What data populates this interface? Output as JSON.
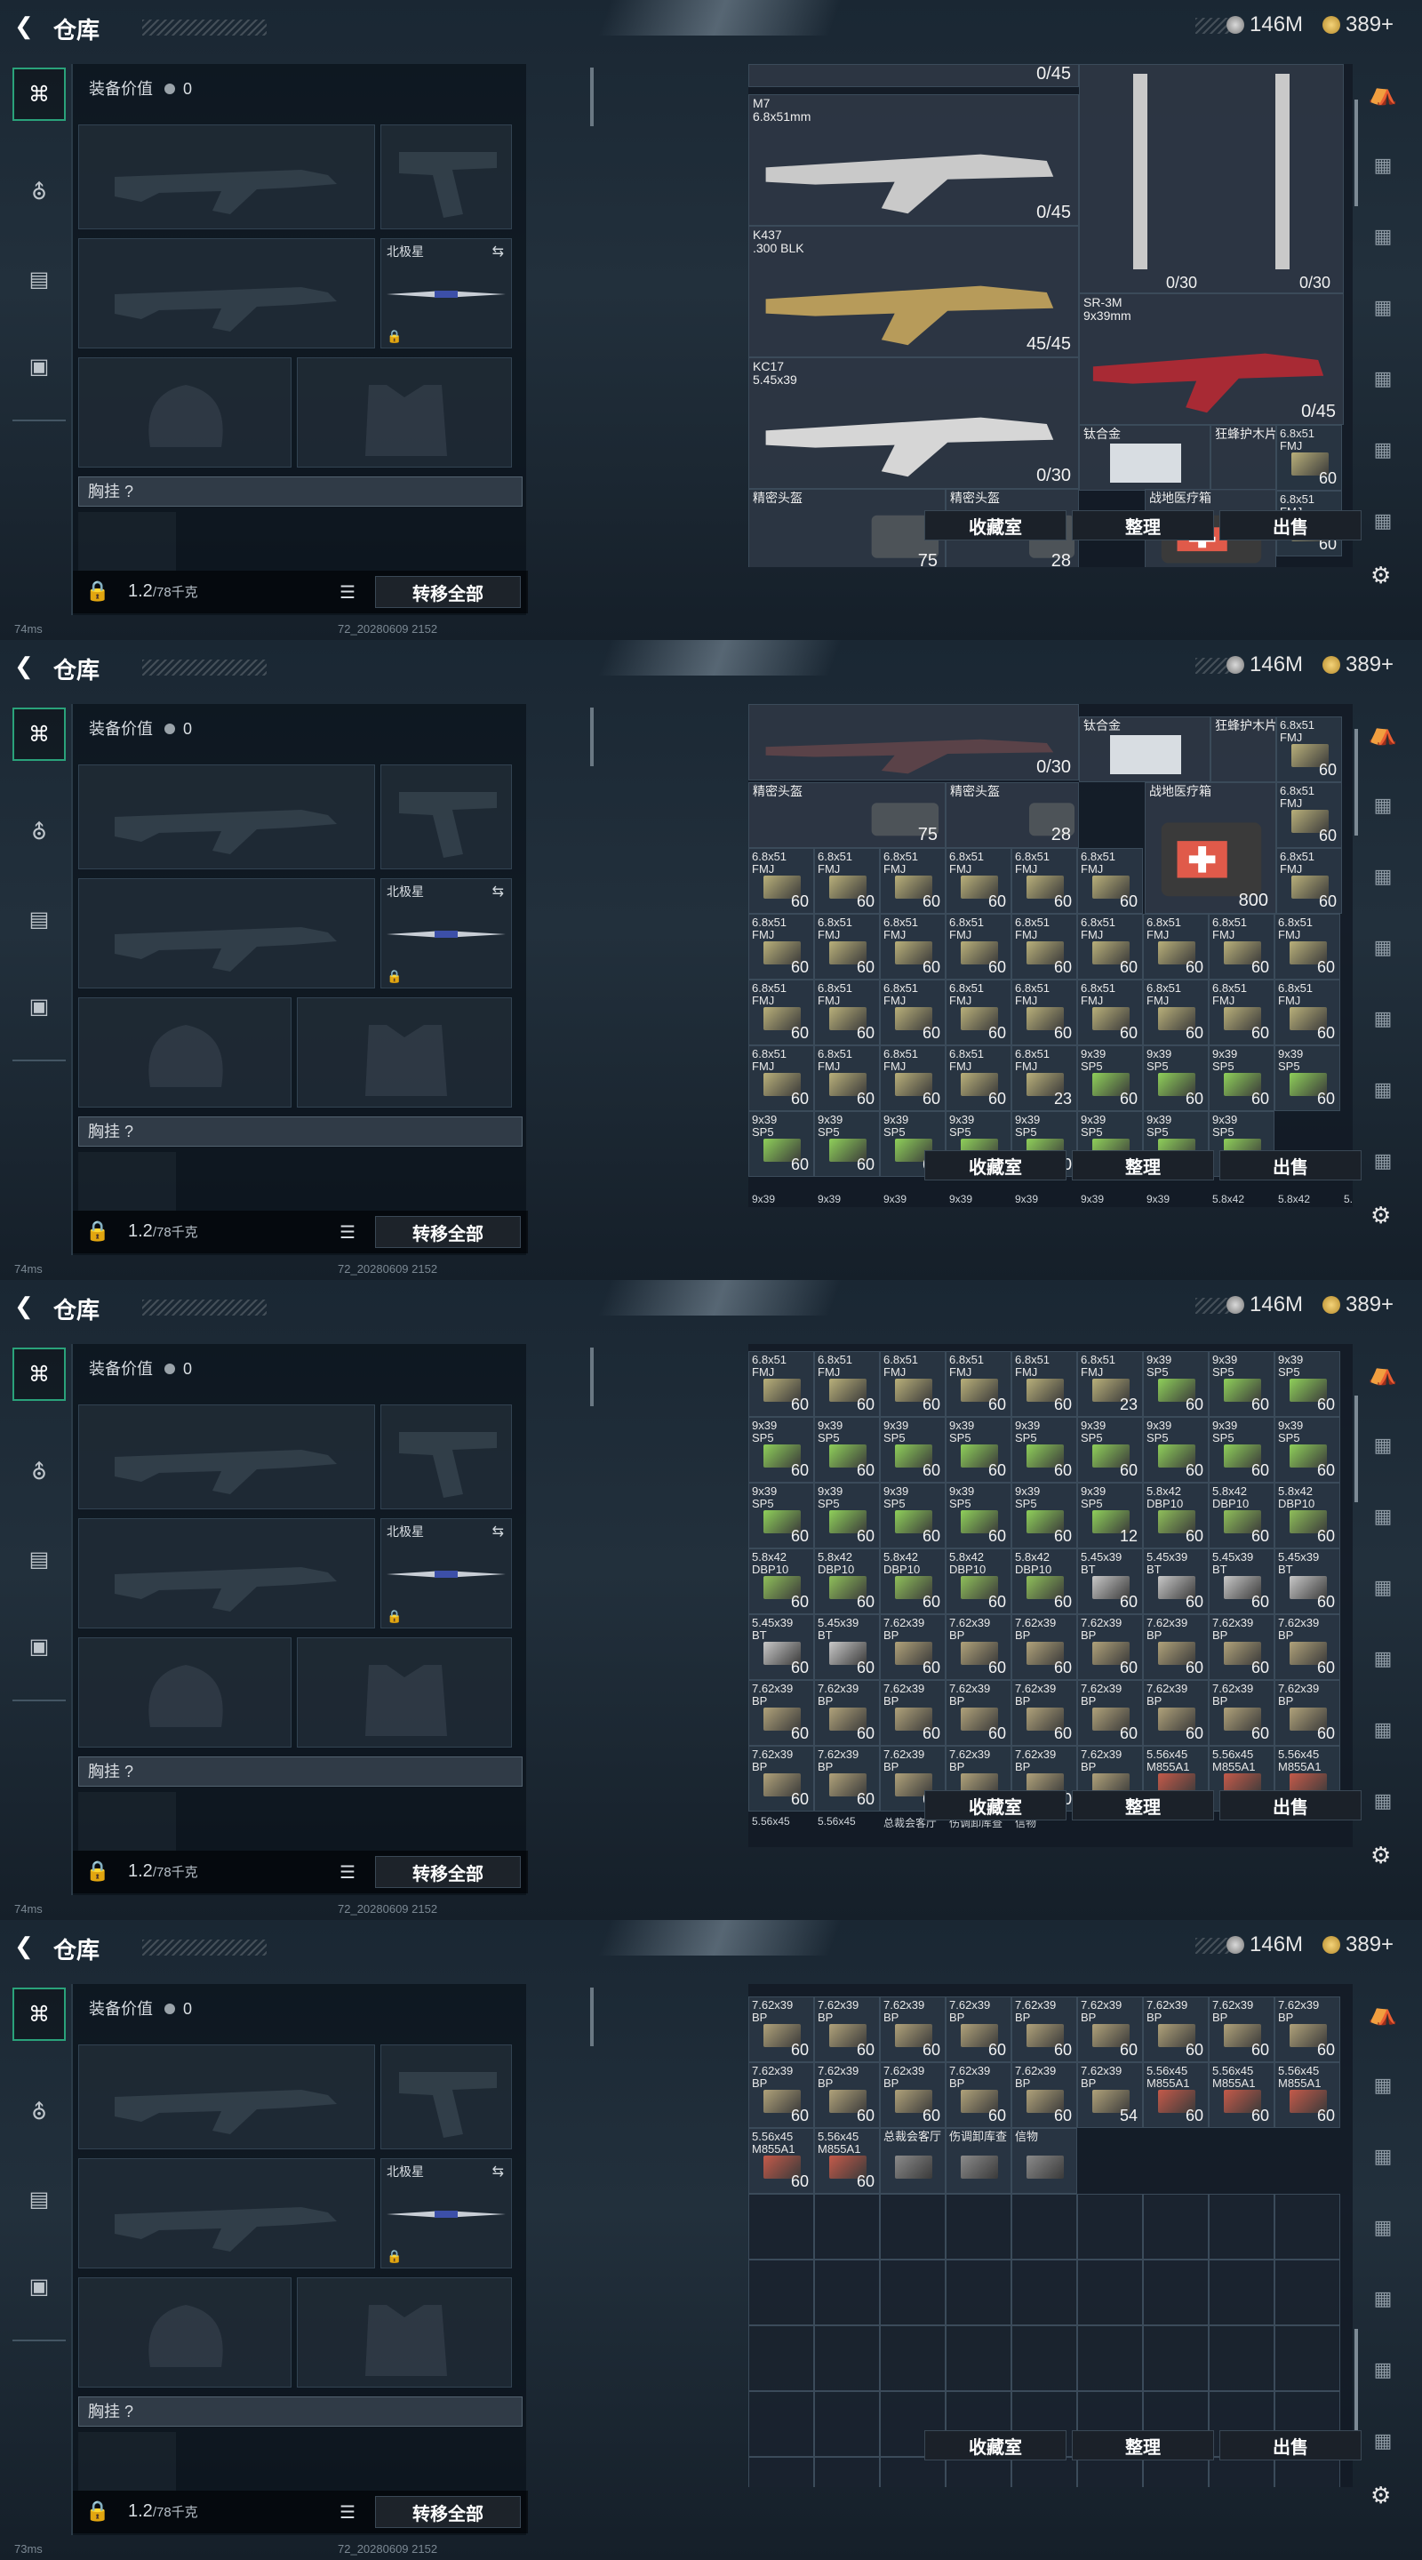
{
  "header": {
    "title": "仓库",
    "silver": "146M",
    "gold": "389+"
  },
  "nav": {
    "items": [
      "weapon-tab-icon",
      "helmet-tab-icon",
      "vest-tab-icon",
      "case-tab-icon"
    ]
  },
  "equipment": {
    "value_label": "装备价值",
    "value": "0",
    "knife_name": "北极星",
    "chest_label": "胸挂 ?",
    "weight_current": "1.2",
    "weight_max": "/78千克",
    "transfer_all": "转移全部"
  },
  "storage": {
    "buttons": {
      "favorites": "收藏室",
      "organize": "整理",
      "sell": "出售"
    },
    "screen1": {
      "top_count": "0/45",
      "m7": {
        "name": "M7\n6.8x51mm",
        "count": "0/45"
      },
      "k437": {
        "name": "K437\n.300 BLK",
        "count": "45/45"
      },
      "kc17": {
        "name": "KC17\n5.45x39",
        "count": "0/30"
      },
      "rifle_upright_count_1": "0/30",
      "rifle_upright_count_2": "0/30",
      "sr3m": {
        "name": "SR-3M\n9x39mm",
        "count": "0/45"
      },
      "ti_alloy": "钛合金",
      "kevlar": "狂蜂护木片",
      "ammo_name": "6.8x51\nFMJ",
      "ammo_count": "60",
      "helmet1": {
        "name": "精密头盔",
        "dur": "75"
      },
      "helmet2": {
        "name": "精密头盔",
        "dur": "28"
      },
      "medkit": {
        "name": "战地医疗箱"
      }
    },
    "screen2": {
      "top_count": "0/45",
      "kc17_count": "0/30",
      "ti_alloy": "钛合金",
      "kevlar": "狂蜂护木片",
      "helmet1": {
        "name": "精密头盔",
        "dur": "75"
      },
      "helmet2": {
        "name": "精密头盔",
        "dur": "28"
      },
      "medkit": {
        "name": "战地医疗箱",
        "count": "800"
      },
      "cells": [
        [
          "6.8x51\nFMJ",
          "60"
        ],
        [
          "6.8x51\nFMJ",
          "60"
        ],
        [
          "6.8x51\nFMJ",
          "60"
        ],
        [
          "6.8x51\nFMJ",
          "60"
        ],
        [
          "6.8x51\nFMJ",
          "60"
        ],
        [
          "6.8x51\nFMJ",
          "60"
        ],
        [
          "6.8x51\nFMJ",
          "60"
        ],
        [
          "6.8x51\nFMJ",
          "60"
        ],
        [
          "6.8x51\nFMJ",
          "60"
        ],
        [
          "6.8x51\nFMJ",
          "60"
        ],
        [
          "6.8x51\nFMJ",
          "60"
        ],
        [
          "6.8x51\nFMJ",
          "60"
        ],
        [
          "6.8x51\nFMJ",
          "60"
        ],
        [
          "6.8x51\nFMJ",
          "60"
        ],
        [
          "6.8x51\nFMJ",
          "60"
        ],
        [
          "6.8x51\nFMJ",
          "60"
        ],
        [
          "6.8x51\nFMJ",
          "60"
        ],
        [
          "6.8x51\nFMJ",
          "60"
        ],
        [
          "6.8x51\nFMJ",
          "60"
        ],
        [
          "6.8x51\nFMJ",
          "60"
        ],
        [
          "6.8x51\nFMJ",
          "60"
        ],
        [
          "6.8x51\nFMJ",
          "60"
        ],
        [
          "6.8x51\nFMJ",
          "60"
        ],
        [
          "6.8x51\nFMJ",
          "60"
        ],
        [
          "6.8x51\nFMJ",
          "60"
        ],
        [
          "6.8x51\nFMJ",
          "60"
        ],
        [
          "6.8x51\nFMJ",
          "60"
        ],
        [
          "6.8x51\nFMJ",
          "60"
        ],
        [
          "6.8x51\nFMJ",
          "60"
        ],
        [
          "6.8x51\nFMJ",
          "23"
        ],
        [
          "9x39\nSP5",
          "60"
        ],
        [
          "9x39\nSP5",
          "60"
        ],
        [
          "9x39\nSP5",
          "60"
        ],
        [
          "9x39\nSP5",
          "60"
        ],
        [
          "9x39\nSP5",
          "60"
        ],
        [
          "9x39\nSP5",
          "60"
        ],
        [
          "9x39\nSP5",
          "60"
        ],
        [
          "9x39\nSP5",
          "60"
        ],
        [
          "9x39\nSP5",
          "60"
        ],
        [
          "9x39\nSP5",
          "60"
        ],
        [
          "9x39\nSP5",
          "60"
        ],
        [
          "9x39\nSP5",
          "60"
        ]
      ],
      "partial_row": [
        "9x39",
        "9x39",
        "9x39",
        "9x39",
        "9x39",
        "9x39",
        "9x39",
        "5.8x42",
        "5.8x42",
        "5.8x42"
      ]
    },
    "screen3": {
      "cells": [
        [
          "6.8x51\nFMJ",
          "60"
        ],
        [
          "6.8x51\nFMJ",
          "60"
        ],
        [
          "6.8x51\nFMJ",
          "60"
        ],
        [
          "6.8x51\nFMJ",
          "60"
        ],
        [
          "6.8x51\nFMJ",
          "60"
        ],
        [
          "6.8x51\nFMJ",
          "23"
        ],
        [
          "9x39\nSP5",
          "60"
        ],
        [
          "9x39\nSP5",
          "60"
        ],
        [
          "9x39\nSP5",
          "60"
        ],
        [
          "9x39\nSP5",
          "60"
        ],
        [
          "9x39\nSP5",
          "60"
        ],
        [
          "9x39\nSP5",
          "60"
        ],
        [
          "9x39\nSP5",
          "60"
        ],
        [
          "9x39\nSP5",
          "60"
        ],
        [
          "9x39\nSP5",
          "60"
        ],
        [
          "9x39\nSP5",
          "60"
        ],
        [
          "9x39\nSP5",
          "60"
        ],
        [
          "9x39\nSP5",
          "60"
        ],
        [
          "9x39\nSP5",
          "60"
        ],
        [
          "9x39\nSP5",
          "60"
        ],
        [
          "9x39\nSP5",
          "60"
        ],
        [
          "9x39\nSP5",
          "60"
        ],
        [
          "9x39\nSP5",
          "60"
        ],
        [
          "9x39\nSP5",
          "12"
        ],
        [
          "5.8x42\nDBP10",
          "60"
        ],
        [
          "5.8x42\nDBP10",
          "60"
        ],
        [
          "5.8x42\nDBP10",
          "60"
        ],
        [
          "5.8x42\nDBP10",
          "60"
        ],
        [
          "5.8x42\nDBP10",
          "60"
        ],
        [
          "5.8x42\nDBP10",
          "60"
        ],
        [
          "5.8x42\nDBP10",
          "60"
        ],
        [
          "5.8x42\nDBP10",
          "60"
        ],
        [
          "5.45x39\nBT",
          "60"
        ],
        [
          "5.45x39\nBT",
          "60"
        ],
        [
          "5.45x39\nBT",
          "60"
        ],
        [
          "5.45x39\nBT",
          "60"
        ],
        [
          "5.45x39\nBT",
          "60"
        ],
        [
          "5.45x39\nBT",
          "60"
        ],
        [
          "7.62x39\nBP",
          "60"
        ],
        [
          "7.62x39\nBP",
          "60"
        ],
        [
          "7.62x39\nBP",
          "60"
        ],
        [
          "7.62x39\nBP",
          "60"
        ],
        [
          "7.62x39\nBP",
          "60"
        ],
        [
          "7.62x39\nBP",
          "60"
        ],
        [
          "7.62x39\nBP",
          "60"
        ],
        [
          "7.62x39\nBP",
          "60"
        ],
        [
          "7.62x39\nBP",
          "60"
        ],
        [
          "7.62x39\nBP",
          "60"
        ],
        [
          "7.62x39\nBP",
          "60"
        ],
        [
          "7.62x39\nBP",
          "60"
        ],
        [
          "7.62x39\nBP",
          "60"
        ],
        [
          "7.62x39\nBP",
          "60"
        ],
        [
          "7.62x39\nBP",
          "60"
        ],
        [
          "7.62x39\nBP",
          "60"
        ],
        [
          "7.62x39\nBP",
          "60"
        ],
        [
          "7.62x39\nBP",
          "60"
        ],
        [
          "7.62x39\nBP",
          "60"
        ],
        [
          "7.62x39\nBP",
          "60"
        ],
        [
          "7.62x39\nBP",
          "60"
        ],
        [
          "7.62x39\nBP",
          "54"
        ],
        [
          "5.56x45\nM855A1",
          "60"
        ],
        [
          "5.56x45\nM855A1",
          "60"
        ],
        [
          "5.56x45\nM855A1",
          "60"
        ]
      ],
      "partial_row": [
        "5.56x45",
        "5.56x45",
        "总裁会客厅",
        "伤调卸库查",
        "信物"
      ]
    },
    "screen4": {
      "cells": [
        [
          "7.62x39\nBP",
          "60"
        ],
        [
          "7.62x39\nBP",
          "60"
        ],
        [
          "7.62x39\nBP",
          "60"
        ],
        [
          "7.62x39\nBP",
          "60"
        ],
        [
          "7.62x39\nBP",
          "60"
        ],
        [
          "7.62x39\nBP",
          "60"
        ],
        [
          "7.62x39\nBP",
          "60"
        ],
        [
          "7.62x39\nBP",
          "60"
        ],
        [
          "7.62x39\nBP",
          "60"
        ],
        [
          "7.62x39\nBP",
          "60"
        ],
        [
          "7.62x39\nBP",
          "60"
        ],
        [
          "7.62x39\nBP",
          "60"
        ],
        [
          "7.62x39\nBP",
          "60"
        ],
        [
          "7.62x39\nBP",
          "60"
        ],
        [
          "7.62x39\nBP",
          "54"
        ],
        [
          "5.56x45\nM855A1",
          "60"
        ],
        [
          "5.56x45\nM855A1",
          "60"
        ],
        [
          "5.56x45\nM855A1",
          "60"
        ],
        [
          "5.56x45\nM855A1",
          "60"
        ],
        [
          "5.56x45\nM855A1",
          "60"
        ],
        [
          "总裁会客厅",
          ""
        ],
        [
          "伤调卸库查",
          ""
        ],
        [
          "信物",
          ""
        ]
      ]
    }
  },
  "footer": {
    "ping": "74ms",
    "ping4": "73ms",
    "build": "72_20280609 2152"
  }
}
